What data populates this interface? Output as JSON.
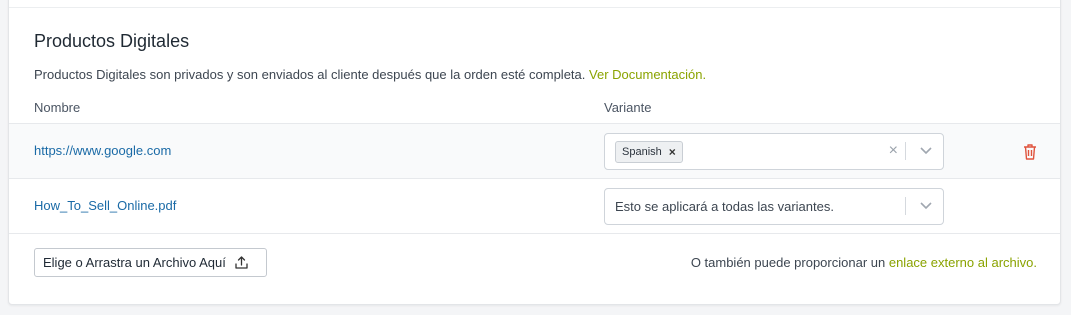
{
  "section": {
    "title": "Productos Digitales",
    "description": "Productos Digitales son privados y son enviados al cliente después que la orden esté completa.",
    "doc_link": "Ver Documentación."
  },
  "table": {
    "columns": {
      "name": "Nombre",
      "variant": "Variante"
    },
    "rows": [
      {
        "file": "https://www.google.com",
        "variant_tag": "Spanish",
        "tag_remove": "×",
        "clear": "×"
      },
      {
        "file": "How_To_Sell_Online.pdf",
        "variant_placeholder": "Esto se aplicará a todas las variantes."
      }
    ]
  },
  "footer": {
    "upload_label": "Elige o Arrastra un Archivo Aquí",
    "external_text": "O también puede proporcionar un",
    "external_link": "enlace externo al archivo."
  },
  "colors": {
    "link_blue": "#1a6aa6",
    "link_green": "#8aa300",
    "delete_red": "#e0533d"
  }
}
